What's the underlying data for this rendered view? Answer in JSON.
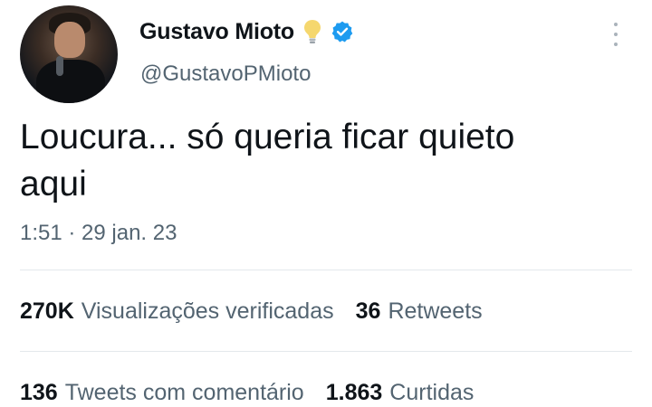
{
  "author": {
    "display_name": "Gustavo Mioto",
    "handle": "@GustavoPMioto",
    "badge_icon": "lightbulb-icon",
    "verified_icon": "verified-badge-icon",
    "verified_color": "#1d9bf0"
  },
  "tweet": {
    "text": "Loucura... só queria ficar quieto\naqui",
    "timestamp": "1:51 · 29 jan. 23"
  },
  "stats": {
    "views": {
      "value": "270K",
      "label": "Visualizações verificadas"
    },
    "retweets": {
      "value": "36",
      "label": "Retweets"
    },
    "quotes": {
      "value": "136",
      "label": "Tweets com comentário"
    },
    "likes": {
      "value": "1.863",
      "label": "Curtidas"
    }
  },
  "colors": {
    "text_primary": "#0f1419",
    "text_secondary": "#536471",
    "divider": "#e3e8ec"
  }
}
